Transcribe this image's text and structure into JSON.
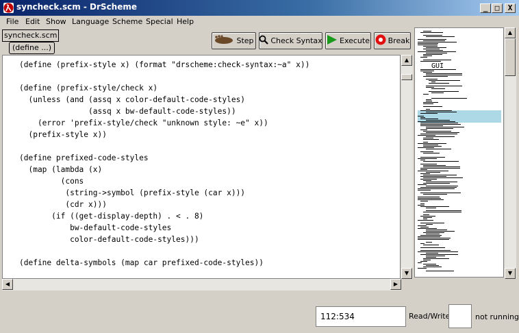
{
  "window": {
    "title": "syncheck.scm - DrScheme",
    "minimize_glyph": "_",
    "maximize_glyph": "□",
    "close_glyph": "X"
  },
  "menubar": {
    "items": [
      "File",
      "Edit",
      "Show",
      "Language",
      "Scheme",
      "Special",
      "Help"
    ]
  },
  "toolbar": {
    "file_name": "syncheck.scm",
    "define_menu": "(define ...)",
    "step_label": "Step",
    "check_syntax_label": "Check Syntax",
    "execute_label": "Execute",
    "break_label": "Break"
  },
  "icons": {
    "app": "drscheme-lambda-icon",
    "step": "footprint-icon",
    "check_syntax": "magnifier-icon",
    "execute": "green-play-arrow-icon",
    "break": "red-stop-icon"
  },
  "colors": {
    "title_start": "#0a246a",
    "title_end": "#a6caf0",
    "overview_highlight": "#add8e6",
    "execute_arrow": "#1a9a1a",
    "break_red": "#e01010"
  },
  "editor": {
    "code_lines": [
      "(define (prefix-style x) (format \"drscheme:check-syntax:~a\" x))",
      "",
      "(define (prefix-style/check x)",
      "  (unless (and (assq x color-default-code-styles)",
      "               (assq x bw-default-code-styles))",
      "    (error 'prefix-style/check \"unknown style: ~e\" x))",
      "  (prefix-style x))",
      "",
      "(define prefixed-code-styles",
      "  (map (lambda (x)",
      "         (cons",
      "          (string->symbol (prefix-style (car x)))",
      "          (cdr x)))",
      "       (if ((get-display-depth) . < . 8)",
      "           bw-default-code-styles",
      "           color-default-code-styles)))",
      "",
      "(define delta-symbols (map car prefixed-code-styles))"
    ]
  },
  "overview": {
    "visible_label": "GUI"
  },
  "status": {
    "position": "112:534",
    "mode": "Read/Write",
    "running": "not running"
  }
}
